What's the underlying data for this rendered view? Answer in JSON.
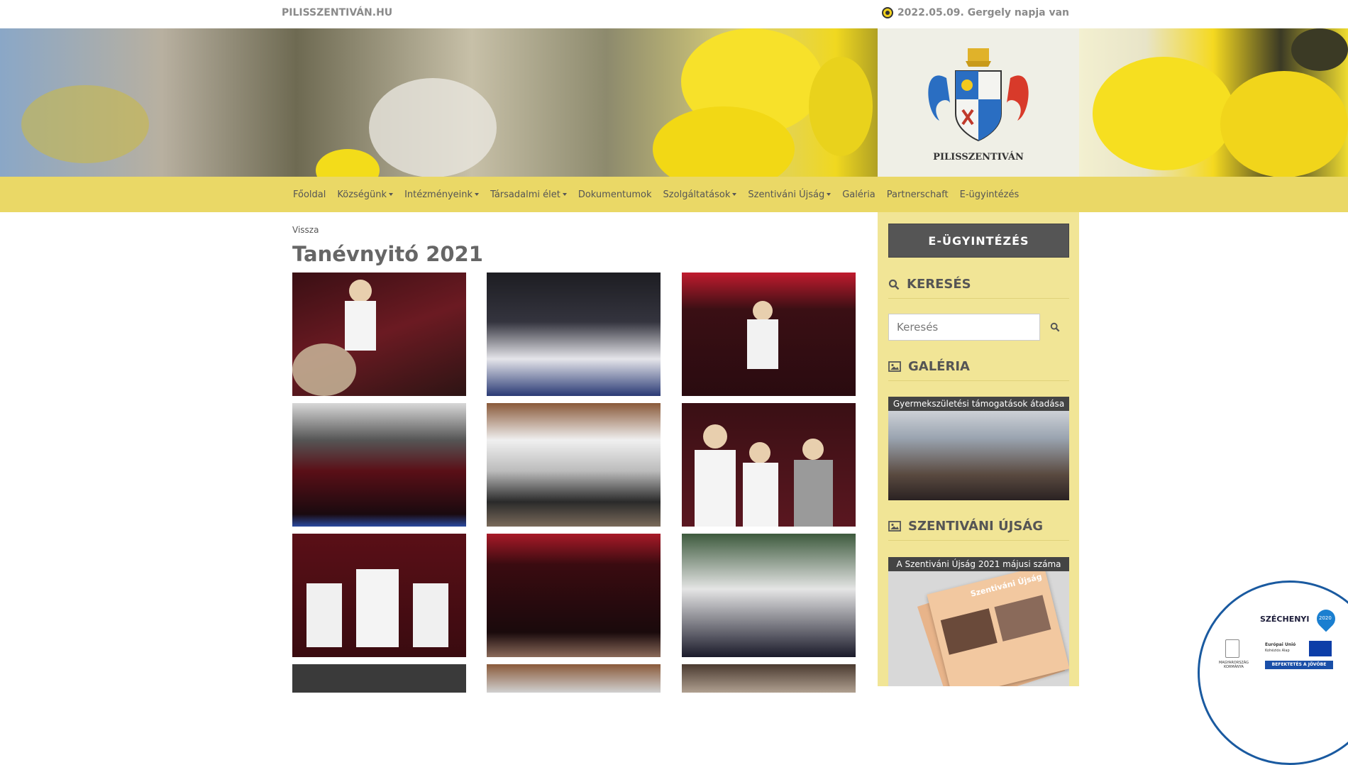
{
  "topbar": {
    "site_name": "PILISSZENTIVÁN.HU",
    "nameday": "2022.05.09. Gergely napja van"
  },
  "banner": {
    "crest_text": "PILISSZENTIVÁN"
  },
  "nav": {
    "items": [
      {
        "label": "Főoldal",
        "dropdown": false
      },
      {
        "label": "Községünk",
        "dropdown": true
      },
      {
        "label": "Intézményeink",
        "dropdown": true
      },
      {
        "label": "Társadalmi élet",
        "dropdown": true
      },
      {
        "label": "Dokumentumok",
        "dropdown": false
      },
      {
        "label": "Szolgáltatások",
        "dropdown": true
      },
      {
        "label": "Szentiváni Újság",
        "dropdown": true
      },
      {
        "label": "Galéria",
        "dropdown": false
      },
      {
        "label": "Partnerschaft",
        "dropdown": false
      },
      {
        "label": "E-ügyintézés",
        "dropdown": false
      }
    ]
  },
  "main": {
    "back_label": "Vissza",
    "title": "Tanévnyitó 2021"
  },
  "sidebar": {
    "e_button": "E-ÜGYINTÉZÉS",
    "search_heading": "KERESÉS",
    "search_placeholder": "Keresés",
    "gallery_heading": "GALÉRIA",
    "gallery_caption": "Gyermekszületési támogatások átadása",
    "newspaper_heading": "SZENTIVÁNI ÚJSÁG",
    "newspaper_caption": "A Szentiváni Újság 2021 májusi száma",
    "newspaper_cover_title": "Szentiváni Újság"
  },
  "szechenyi": {
    "title": "SZÉCHENYI",
    "year": "2020",
    "gov": "MAGYARORSZÁG KORMÁNYA",
    "eu": "Európai Unió",
    "fund": "Kohéziós Alap",
    "slogan": "BEFEKTETÉS A JÖVŐBE"
  },
  "colors": {
    "nav_bg": "#ead866",
    "sidebar_bg": "#f1e596",
    "button_bg": "#555555"
  }
}
